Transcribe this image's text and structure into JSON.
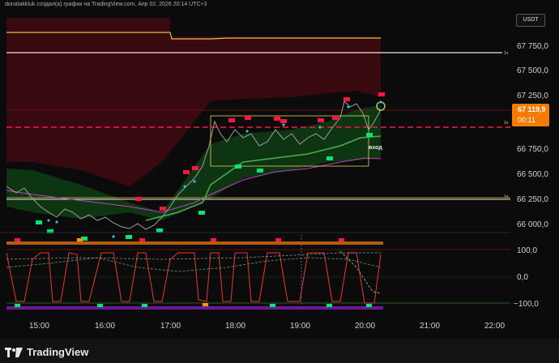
{
  "header": {
    "attribution": "donatakkluk создал(а) график на TradingView.com, Апр 02, 2026 20:14 UTC+3"
  },
  "price_axis": {
    "currency_label": "USDT",
    "labels": [
      "67 750,0",
      "67 500,0",
      "67 250,0",
      "66 750,0",
      "66 500,0",
      "66 250,0",
      "66 000,0"
    ],
    "current_price": "67 119,9",
    "countdown": "00:11"
  },
  "oscillator_axis": {
    "labels": [
      "100,0",
      "0,0",
      "−100,0"
    ]
  },
  "time_axis": {
    "labels": [
      "15:00",
      "16:00",
      "17:00",
      "18:00",
      "19:00",
      "20:00",
      "21:00",
      "22:00"
    ]
  },
  "annotations": {
    "entry_label": "вход"
  },
  "footer": {
    "logo_text": "TradingView"
  },
  "colors": {
    "accent": "#f57c00",
    "bull": "#00e676",
    "bear": "#ff1744",
    "diamond": "#26c6da",
    "band_fill": "#4a0a12"
  }
}
